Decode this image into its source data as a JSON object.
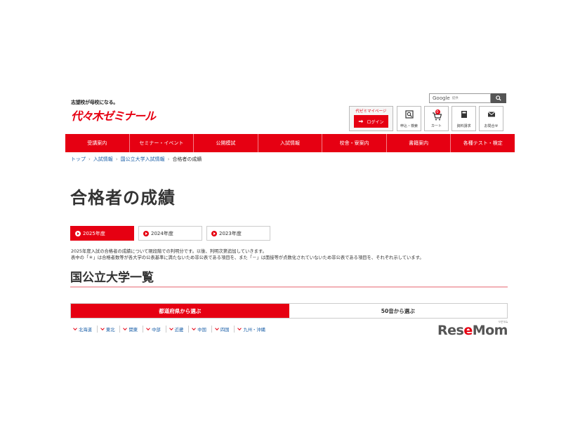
{
  "header": {
    "tagline": "志望校が母校になる。",
    "logo_text": "代々木ゼミナール",
    "search": {
      "brand": "Google",
      "placeholder": "提供"
    },
    "mypage": {
      "title": "代ゼミマイページ",
      "login_label": "ログイン"
    },
    "utilities": [
      {
        "label": "申込・検索",
        "icon": "search-icon"
      },
      {
        "label": "カート",
        "icon": "cart-icon",
        "badge": "0"
      },
      {
        "label": "資料請求",
        "icon": "book-icon"
      },
      {
        "label": "お問合せ",
        "icon": "mail-icon"
      }
    ]
  },
  "nav": {
    "items": [
      "受講案内",
      "セミナー・イベント",
      "公開模試",
      "入試情報",
      "校舎・寮案内",
      "書籍案内",
      "各種テスト・検定"
    ]
  },
  "breadcrumb": {
    "items": [
      "トップ",
      "入試情報",
      "国公立大学入試情報"
    ],
    "current": "合格者の成績"
  },
  "page": {
    "title": "合格者の成績",
    "years": [
      "2025年度",
      "2024年度",
      "2023年度"
    ],
    "notes": [
      "2025年度入試の合格者の成績について現段階での判明分です。以後、判明次第追加していきます。",
      "表中の「＊」は合格者数等が各大学の公表基準に満たないため非公表である項目を、また「－」は面接等が点数化されていないため非公表である項目を、それぞれ示しています。"
    ],
    "section_title": "国公立大学一覧",
    "tabs": [
      "都道府県から選ぶ",
      "50音から選ぶ"
    ],
    "regions": [
      "北海道",
      "東北",
      "関東",
      "中部",
      "近畿",
      "中国",
      "四国",
      "九州・沖縄"
    ]
  },
  "watermark": {
    "text_a": "Res",
    "text_e": "e",
    "text_b": "Mom",
    "kana": "リセマム"
  },
  "colors": {
    "brand_red": "#e60012",
    "link_blue": "#1a5fa8"
  }
}
